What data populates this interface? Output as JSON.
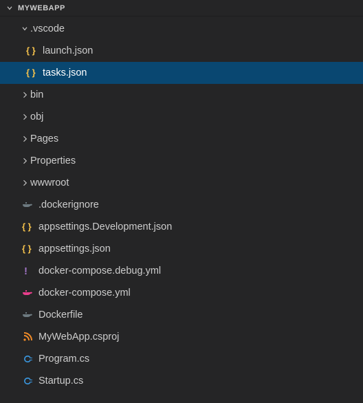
{
  "header": {
    "title": "MYWEBAPP"
  },
  "tree": [
    {
      "id": "vscode",
      "depth": 1,
      "kind": "folder",
      "open": true,
      "icon": "folder-open",
      "label": ".vscode",
      "selected": false
    },
    {
      "id": "launch-json",
      "depth": 2,
      "kind": "file",
      "open": null,
      "icon": "json",
      "label": "launch.json",
      "selected": false
    },
    {
      "id": "tasks-json",
      "depth": 2,
      "kind": "file",
      "open": null,
      "icon": "json",
      "label": "tasks.json",
      "selected": true
    },
    {
      "id": "bin",
      "depth": 1,
      "kind": "folder",
      "open": false,
      "icon": "folder",
      "label": "bin",
      "selected": false
    },
    {
      "id": "obj",
      "depth": 1,
      "kind": "folder",
      "open": false,
      "icon": "folder",
      "label": "obj",
      "selected": false
    },
    {
      "id": "pages",
      "depth": 1,
      "kind": "folder",
      "open": false,
      "icon": "folder",
      "label": "Pages",
      "selected": false
    },
    {
      "id": "properties",
      "depth": 1,
      "kind": "folder",
      "open": false,
      "icon": "folder",
      "label": "Properties",
      "selected": false
    },
    {
      "id": "wwwroot",
      "depth": 1,
      "kind": "folder",
      "open": false,
      "icon": "folder",
      "label": "wwwroot",
      "selected": false
    },
    {
      "id": "dockerignore",
      "depth": 1,
      "kind": "file",
      "open": null,
      "icon": "docker-gray",
      "label": ".dockerignore",
      "selected": false
    },
    {
      "id": "appdev",
      "depth": 1,
      "kind": "file",
      "open": null,
      "icon": "json",
      "label": "appsettings.Development.json",
      "selected": false
    },
    {
      "id": "appsettings",
      "depth": 1,
      "kind": "file",
      "open": null,
      "icon": "json",
      "label": "appsettings.json",
      "selected": false
    },
    {
      "id": "dcdebug",
      "depth": 1,
      "kind": "file",
      "open": null,
      "icon": "yaml",
      "label": "docker-compose.debug.yml",
      "selected": false
    },
    {
      "id": "dcyml",
      "depth": 1,
      "kind": "file",
      "open": null,
      "icon": "docker-pink",
      "label": "docker-compose.yml",
      "selected": false
    },
    {
      "id": "dockerfile",
      "depth": 1,
      "kind": "file",
      "open": null,
      "icon": "docker-gray",
      "label": "Dockerfile",
      "selected": false
    },
    {
      "id": "csproj",
      "depth": 1,
      "kind": "file",
      "open": null,
      "icon": "rss",
      "label": "MyWebApp.csproj",
      "selected": false
    },
    {
      "id": "program",
      "depth": 1,
      "kind": "file",
      "open": null,
      "icon": "csharp",
      "label": "Program.cs",
      "selected": false
    },
    {
      "id": "startup",
      "depth": 1,
      "kind": "file",
      "open": null,
      "icon": "csharp",
      "label": "Startup.cs",
      "selected": false
    }
  ],
  "icons": {
    "colors": {
      "json": "#f5c24c",
      "yaml": "#a074c4",
      "docker-gray": "#6d7a80",
      "docker-pink": "#e83e8c",
      "rss": "#f28c28",
      "csharp": "#3a96dd"
    }
  }
}
